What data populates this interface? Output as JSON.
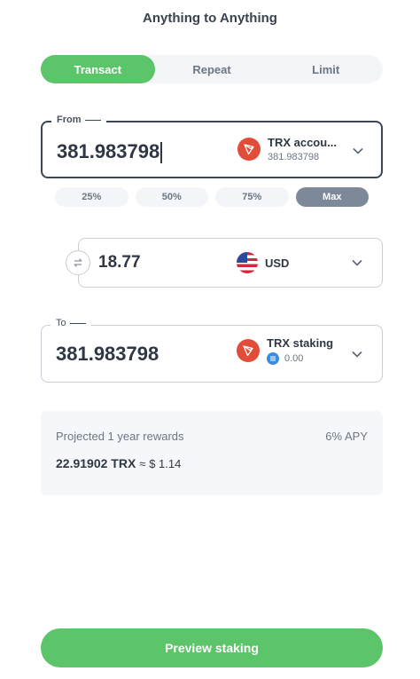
{
  "header": {
    "title": "Anything to Anything"
  },
  "tabs": [
    {
      "label": "Transact",
      "active": true
    },
    {
      "label": "Repeat",
      "active": false
    },
    {
      "label": "Limit",
      "active": false
    }
  ],
  "from": {
    "legend": "From",
    "amount": "381.983798",
    "asset_name": "TRX accou...",
    "asset_balance": "381.983798",
    "asset_icon": "tron-icon"
  },
  "percent_buttons": [
    {
      "label": "25%",
      "active": false
    },
    {
      "label": "50%",
      "active": false
    },
    {
      "label": "75%",
      "active": false
    },
    {
      "label": "Max",
      "active": true
    }
  ],
  "fiat": {
    "amount": "18.77",
    "currency": "USD",
    "flag_icon": "us-flag-icon"
  },
  "to": {
    "legend": "To",
    "amount": "381.983798",
    "asset_name": "TRX staking",
    "asset_balance": "0.00",
    "asset_icon": "tron-icon"
  },
  "rewards": {
    "label": "Projected 1 year rewards",
    "apy": "6% APY",
    "value_trx": "22.91902 TRX",
    "approx": "≈",
    "value_usd": "$ 1.14"
  },
  "footer": {
    "button_label": "Preview staking"
  },
  "colors": {
    "accent_green": "#5cc56a",
    "tron_red": "#e24d3a",
    "coin_blue": "#3a8de0"
  }
}
